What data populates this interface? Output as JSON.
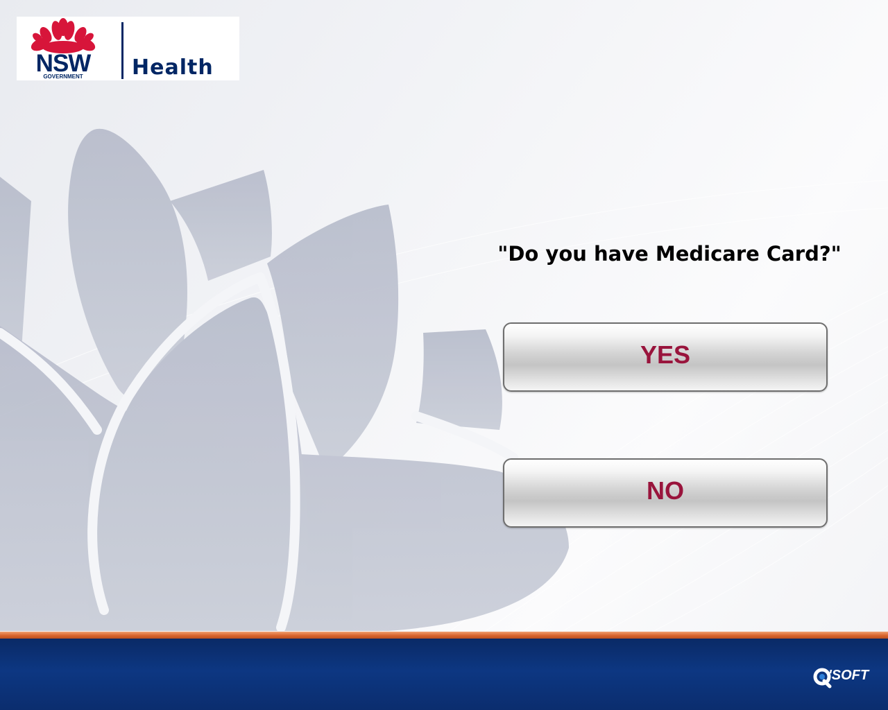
{
  "header": {
    "logo": {
      "nsw": "NSW",
      "government": "GOVERNMENT",
      "health": "Health"
    }
  },
  "main": {
    "question": "\"Do you have Medicare Card?\"",
    "buttons": {
      "yes": "YES",
      "no": "NO"
    }
  },
  "footer": {
    "vendor_logo": "'SOFT"
  },
  "colors": {
    "button_text": "#99143c",
    "nsw_blue": "#002664",
    "waratah_red": "#d7153a",
    "footer_blue": "#0d3782",
    "footer_stripe": "#d9652e"
  },
  "icons": {
    "waratah": "waratah-flower-icon",
    "vendor": "qsoft-logo-icon"
  }
}
